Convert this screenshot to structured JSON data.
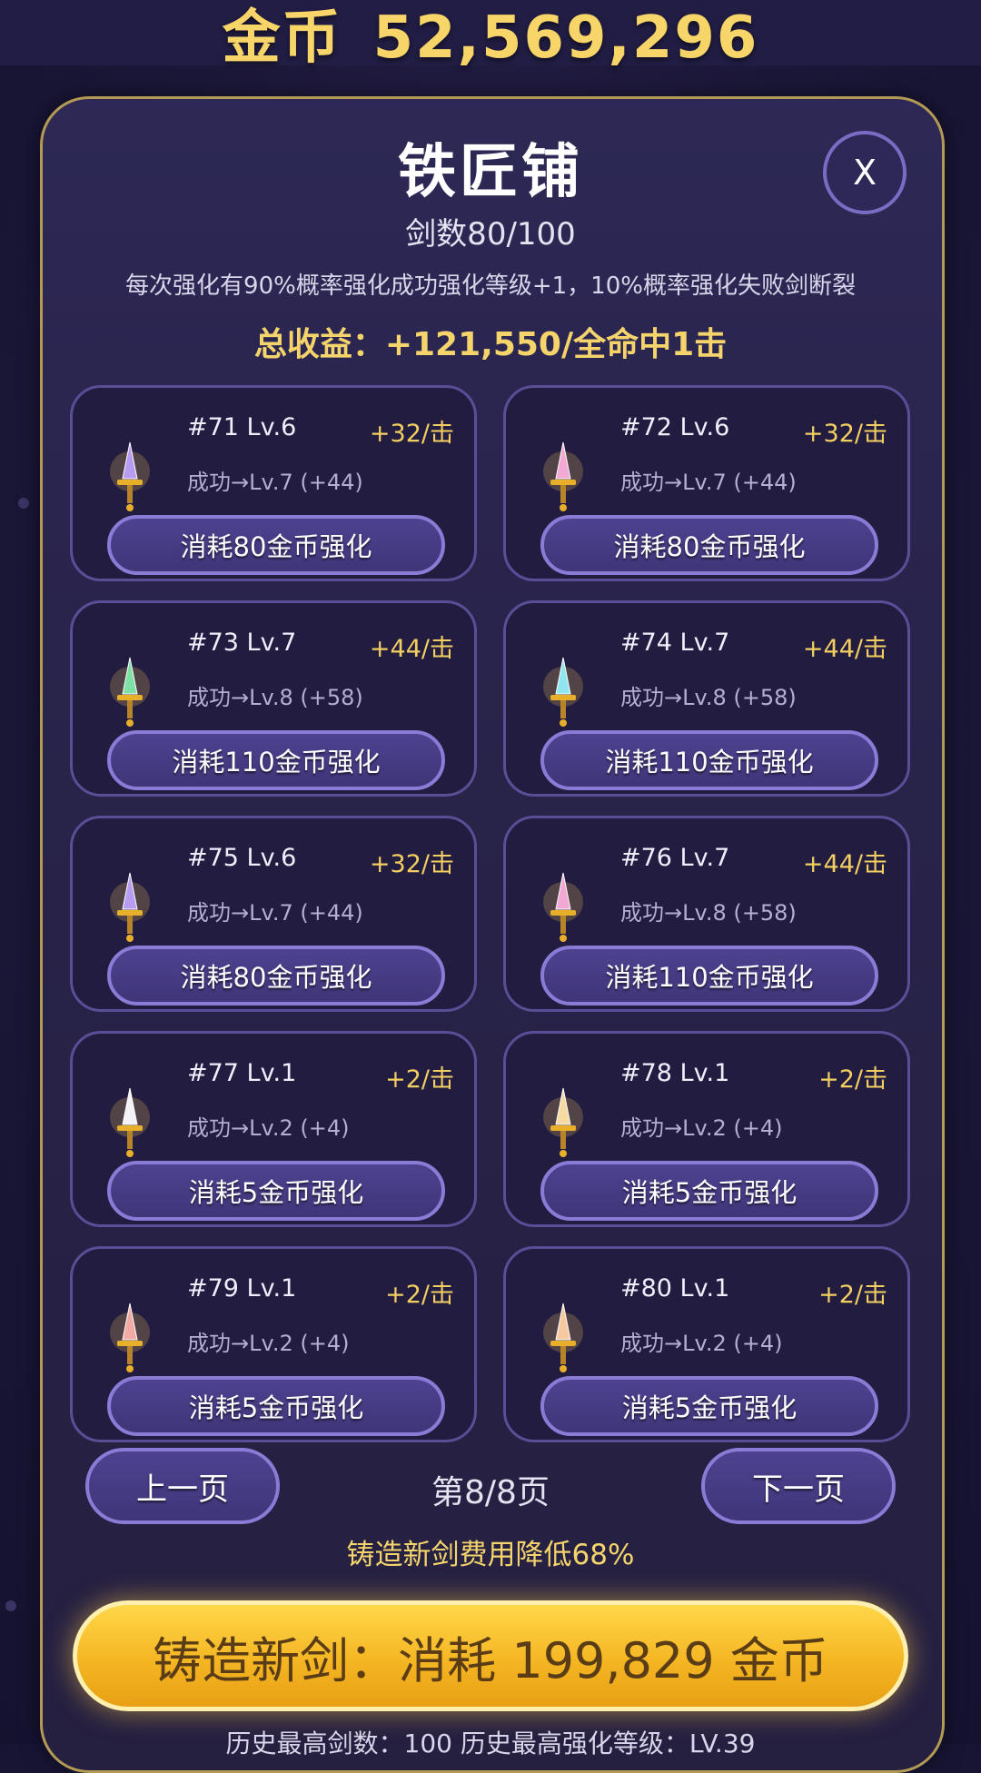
{
  "header": {
    "gold_label": "金币",
    "gold_value": "52,569,296"
  },
  "panel": {
    "title": "铁匠铺",
    "close_label": "X",
    "sword_count": "剑数80/100",
    "rule_text": "每次强化有90%概率强化成功强化等级+1，10%概率强化失败剑断裂",
    "total_income": "总收益：+121,550/全命中1击"
  },
  "swords": [
    {
      "id": "#71  Lv.6",
      "gain": "+32/击",
      "next": "成功→Lv.7 (+44)",
      "button": "消耗80金币强化",
      "color": "#b89cf2"
    },
    {
      "id": "#72  Lv.6",
      "gain": "+32/击",
      "next": "成功→Lv.7 (+44)",
      "button": "消耗80金币强化",
      "color": "#f2a8d4"
    },
    {
      "id": "#73  Lv.7",
      "gain": "+44/击",
      "next": "成功→Lv.8 (+58)",
      "button": "消耗110金币强化",
      "color": "#7fe0a6"
    },
    {
      "id": "#74  Lv.7",
      "gain": "+44/击",
      "next": "成功→Lv.8 (+58)",
      "button": "消耗110金币强化",
      "color": "#8fe6f0"
    },
    {
      "id": "#75  Lv.6",
      "gain": "+32/击",
      "next": "成功→Lv.7 (+44)",
      "button": "消耗80金币强化",
      "color": "#b89cf2"
    },
    {
      "id": "#76  Lv.7",
      "gain": "+44/击",
      "next": "成功→Lv.8 (+58)",
      "button": "消耗110金币强化",
      "color": "#f2a8d4"
    },
    {
      "id": "#77  Lv.1",
      "gain": "+2/击",
      "next": "成功→Lv.2 (+4)",
      "button": "消耗5金币强化",
      "color": "#f4f2f6"
    },
    {
      "id": "#78  Lv.1",
      "gain": "+2/击",
      "next": "成功→Lv.2 (+4)",
      "button": "消耗5金币强化",
      "color": "#f7d9a2"
    },
    {
      "id": "#79  Lv.1",
      "gain": "+2/击",
      "next": "成功→Lv.2 (+4)",
      "button": "消耗5金币强化",
      "color": "#f3a9a4"
    },
    {
      "id": "#80  Lv.1",
      "gain": "+2/击",
      "next": "成功→Lv.2 (+4)",
      "button": "消耗5金币强化",
      "color": "#f7c9a0"
    }
  ],
  "pagination": {
    "prev_label": "上一页",
    "page_text": "第8/8页",
    "next_label": "下一页"
  },
  "discount_text": "铸造新剑费用降低68%",
  "forge": {
    "label": "铸造新剑：消耗 199,829 金币"
  },
  "history_text": "历史最高剑数：100   历史最高强化等级：LV.39",
  "icons": {
    "sword": "sword-icon",
    "close": "close-icon"
  },
  "colors": {
    "gold_text": "#f5d56b",
    "panel_border": "#b39a55",
    "button_purple": "#4d4290",
    "forge_gold": "#f5b623"
  }
}
